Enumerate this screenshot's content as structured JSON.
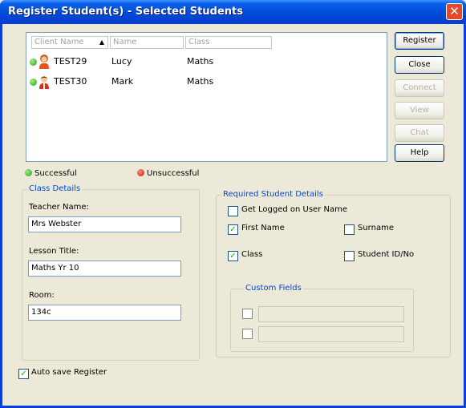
{
  "window": {
    "title": "Register Student(s) - Selected Students",
    "close_glyph": "✕"
  },
  "list": {
    "columns": [
      "Client Name",
      "Name",
      "Class"
    ],
    "sort_glyph": "▲",
    "rows": [
      {
        "client": "TEST29",
        "name": "Lucy",
        "class": "Maths"
      },
      {
        "client": "TEST30",
        "name": "Mark",
        "class": "Maths"
      }
    ]
  },
  "buttons": {
    "register": "Register",
    "close": "Close",
    "connect": "Connect",
    "view": "View",
    "chat": "Chat",
    "help": "Help"
  },
  "legend": {
    "successful": "Successful",
    "unsuccessful": "Unsuccessful"
  },
  "class_details": {
    "title": "Class Details",
    "teacher_label": "Teacher Name:",
    "teacher_value": "Mrs Webster",
    "lesson_label": "Lesson Title:",
    "lesson_value": "Maths Yr 10",
    "room_label": "Room:",
    "room_value": "134c"
  },
  "required": {
    "title": "Required Student Details",
    "get_logged": "Get Logged on User Name",
    "first_name": "First Name",
    "surname": "Surname",
    "class": "Class",
    "student_id": "Student ID/No",
    "check_glyph": "✓"
  },
  "custom_fields": {
    "title": "Custom Fields"
  },
  "autosave": {
    "label": "Auto save Register"
  },
  "colors": {
    "title_bar": "#0a5ee8",
    "group_title": "#0046d5",
    "success": "#2c9a1e",
    "failure": "#c71e10"
  }
}
